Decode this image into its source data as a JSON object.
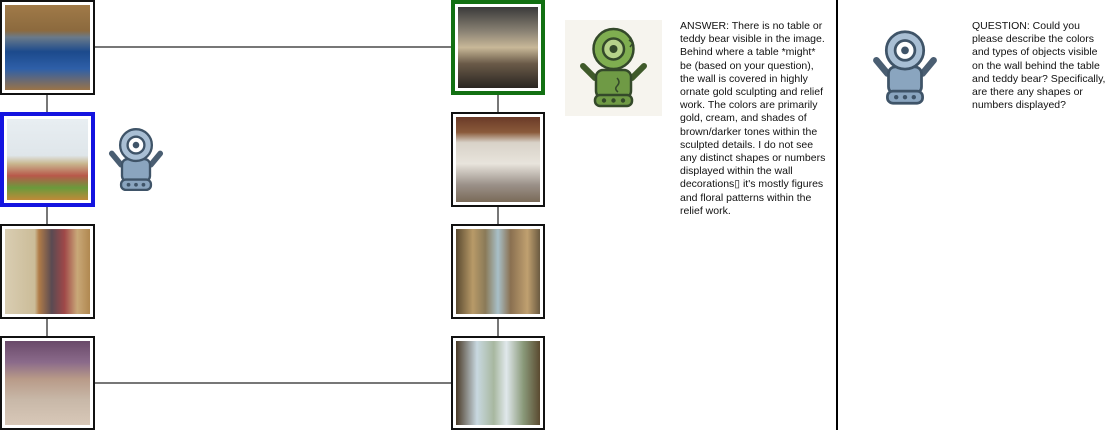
{
  "answer_text": "ANSWER: There is no table or teddy bear visible in the image. Behind where a table *might* be (based on your question), the wall is covered in highly ornate gold sculpting and relief work. The colors are primarily gold, cream, and shades of brown/darker tones within the sculpted details. I do not see any distinct shapes or numbers displayed within the wall decorations▯ it's mostly figures and floral patterns within the relief work.",
  "question_text": "QUESTION: Could you please describe the colors and types of objects visible on the wall behind the table and teddy bear? Specifically, are there any shapes or numbers displayed?",
  "colors": {
    "current_frame": "#1414e0",
    "target_frame": "#127012",
    "tile_frame": "#111111",
    "answerer_robot": "#6f9a45",
    "questioner_robot": "#7f9bb5"
  },
  "icons": {
    "questioner": "robot-icon",
    "answerer": "robot-icon"
  }
}
